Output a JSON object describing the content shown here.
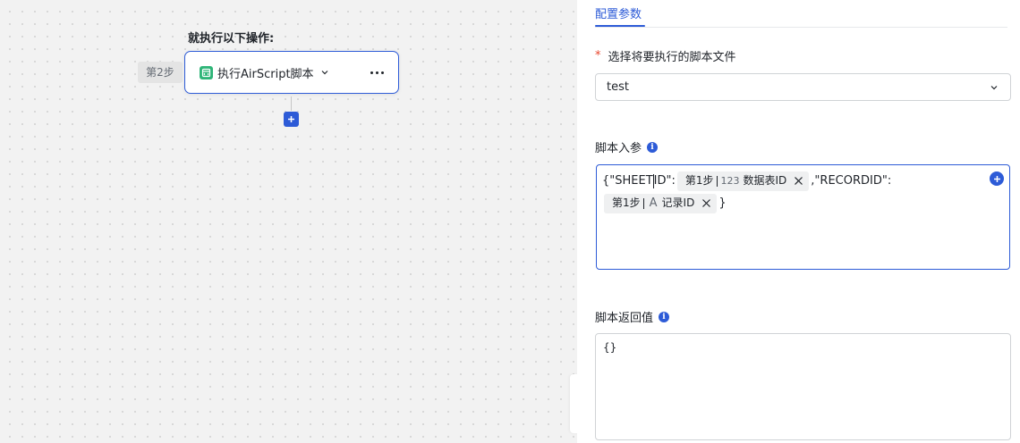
{
  "canvas": {
    "flow_title": "就执行以下操作:",
    "step_badge": "第2步",
    "step_title": "执行AirScript脚本",
    "icons": [
      "script-icon",
      "chevron-down-icon",
      "more-icon",
      "plus-icon",
      "chevron-right-icon"
    ]
  },
  "panel": {
    "tab_label": "配置参数",
    "script_file": {
      "required_mark": "*",
      "label": "选择将要执行的脚本文件",
      "value": "test"
    },
    "params": {
      "label": "脚本入参",
      "info": "i",
      "seg1": "{\"SHEET",
      "seg1b": "ID\":",
      "chip1": {
        "step": "第1步",
        "type": "123",
        "name": "数据表ID"
      },
      "seg2": ",\"RECORDID\":",
      "chip2": {
        "step": "第1步",
        "type": "A",
        "name": "记录ID"
      },
      "seg3": "}"
    },
    "return_value": {
      "label": "脚本返回值",
      "info": "i",
      "value": "{}"
    }
  },
  "colors": {
    "accent": "#2d5bd7",
    "script_icon": "#2fb578",
    "required": "#e8452c"
  }
}
